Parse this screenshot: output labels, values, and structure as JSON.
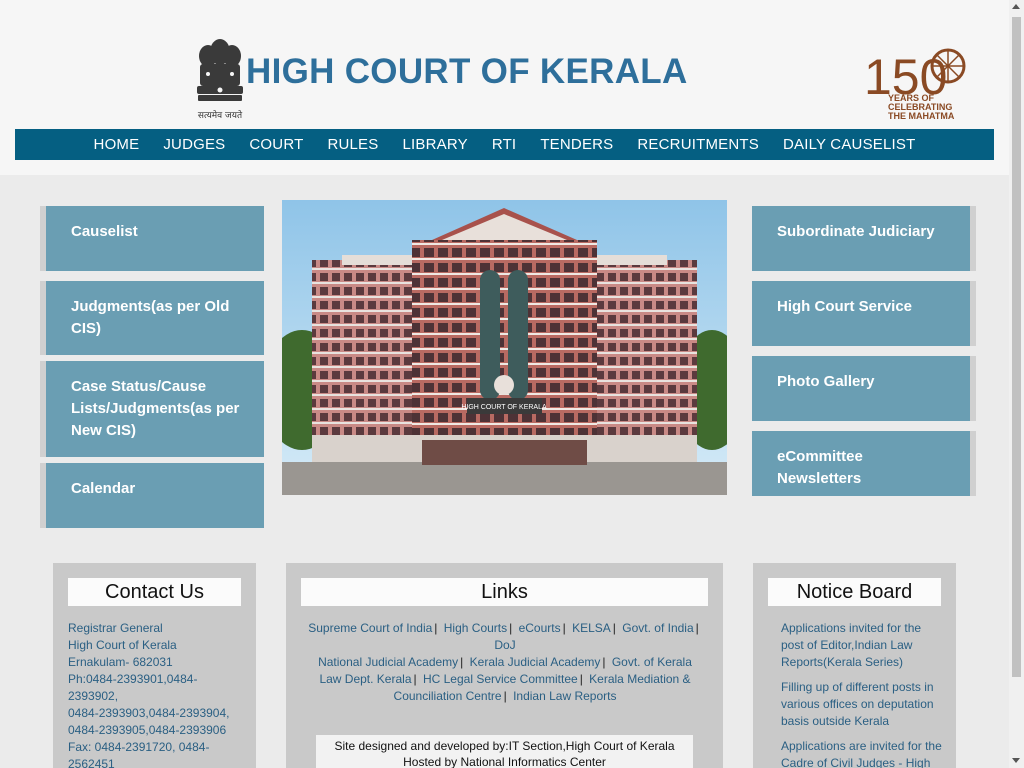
{
  "header": {
    "title": "HIGH COURT OF KERALA",
    "emblem_text": "सत्यमेव जयते",
    "logo_number": "150",
    "logo_caption": [
      "YEARS OF",
      "CELEBRATING",
      "THE MAHATMA"
    ],
    "icons": [
      "national-emblem-icon",
      "gandhi-150-logo"
    ]
  },
  "nav": [
    "HOME",
    "JUDGES",
    "COURT",
    "RULES",
    "LIBRARY",
    "RTI",
    "TENDERS",
    "RECRUITMENTS",
    "DAILY CAUSELIST"
  ],
  "left_tiles": [
    {
      "label": "Causelist"
    },
    {
      "label": "Judgments(as per Old CIS)"
    },
    {
      "label": "Case Status/Cause Lists/Judgments(as per New CIS)"
    },
    {
      "label": "Calendar"
    }
  ],
  "right_tiles": [
    {
      "label": "Subordinate Judiciary"
    },
    {
      "label": "High Court Service"
    },
    {
      "label": "Photo Gallery"
    },
    {
      "label": "eCommittee Newsletters"
    }
  ],
  "center_image": {
    "sign_text": "HIGH COURT OF KERALA"
  },
  "contact": {
    "title": "Contact Us",
    "lines": [
      "Registrar General",
      "High Court of Kerala",
      "Ernakulam- 682031",
      "Ph:0484-2393901,0484-2393902,",
      "0484-2393903,0484-2393904,",
      "0484-2393905,0484-2393906",
      "Fax: 0484-2391720, 0484-2562451"
    ]
  },
  "links": {
    "title": "Links",
    "rows": [
      [
        "Supreme Court of India",
        "High Courts",
        "eCourts",
        "KELSA",
        "Govt. of India",
        "DoJ"
      ],
      [
        "National Judicial Academy",
        "Kerala Judicial Academy",
        "Govt. of Kerala"
      ],
      [
        "Law Dept. Kerala",
        "HC Legal Service Committee",
        "Kerala Mediation & Counciliation Centre",
        "Indian Law Reports"
      ]
    ],
    "separator": "|",
    "footer": [
      "Site designed and developed by:IT Section,High Court of Kerala",
      "Hosted by National Informatics Center"
    ]
  },
  "notice": {
    "title": "Notice Board",
    "items": [
      "Applications invited for the post of Editor,Indian Law Reports(Kerala Series)",
      "Filling up of different posts in various offices on deputation basis outside Kerala",
      "Applications are invited for the Cadre of Civil Judges - High"
    ]
  },
  "colors": {
    "nav_bg": "#055f82",
    "tile_bg": "#6a9eb3",
    "title": "#2e6f9b",
    "link": "#2a5f83"
  }
}
